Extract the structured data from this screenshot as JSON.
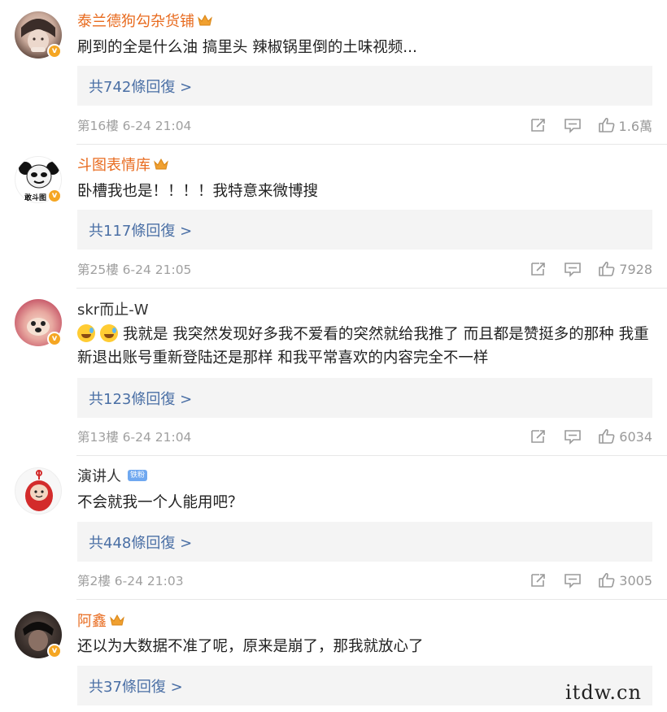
{
  "comments": [
    {
      "username": "泰兰德狗勾杂货铺",
      "text": "刷到的全是什么油 搞里头 辣椒锅里倒的土味视频...",
      "replies": "共742條回復 >",
      "meta": "第16樓 6-24 21:04",
      "likes": "1.6萬"
    },
    {
      "username": "斗图表情库",
      "text": "卧槽我也是！！！！我特意来微博搜",
      "replies": "共117條回復 >",
      "meta": "第25樓 6-24 21:05",
      "likes": "7928",
      "avatar_text": "敢斗图"
    },
    {
      "username": "skr而止-W",
      "text": "我就是 我突然发现好多我不爱看的突然就给我推了 而且都是赞挺多的那种 我重新退出账号重新登陆还是那样 和我平常喜欢的内容完全不一样",
      "replies": "共123條回復 >",
      "meta": "第13樓 6-24 21:04",
      "likes": "6034"
    },
    {
      "username": "演讲人",
      "fan_badge": "铁粉",
      "text": "不会就我一个人能用吧？",
      "replies": "共448條回復 >",
      "meta": "第2樓 6-24 21:03",
      "likes": "3005"
    },
    {
      "username": "阿鑫",
      "text": "还以为大数据不准了呢，原来是崩了，那我就放心了",
      "replies": "共37條回復 >"
    }
  ],
  "watermark": "itdw.cn",
  "colors": {
    "vip_name": "#e86b1f",
    "reply_link": "#4a6fa5",
    "reply_bg": "#f4f4f4",
    "meta": "#a0a0a0",
    "verified_badge": "#f5a623"
  },
  "icons": [
    "share-icon",
    "comment-icon",
    "like-icon",
    "crown-icon",
    "verified-badge-icon",
    "laughing-emoji-icon"
  ]
}
